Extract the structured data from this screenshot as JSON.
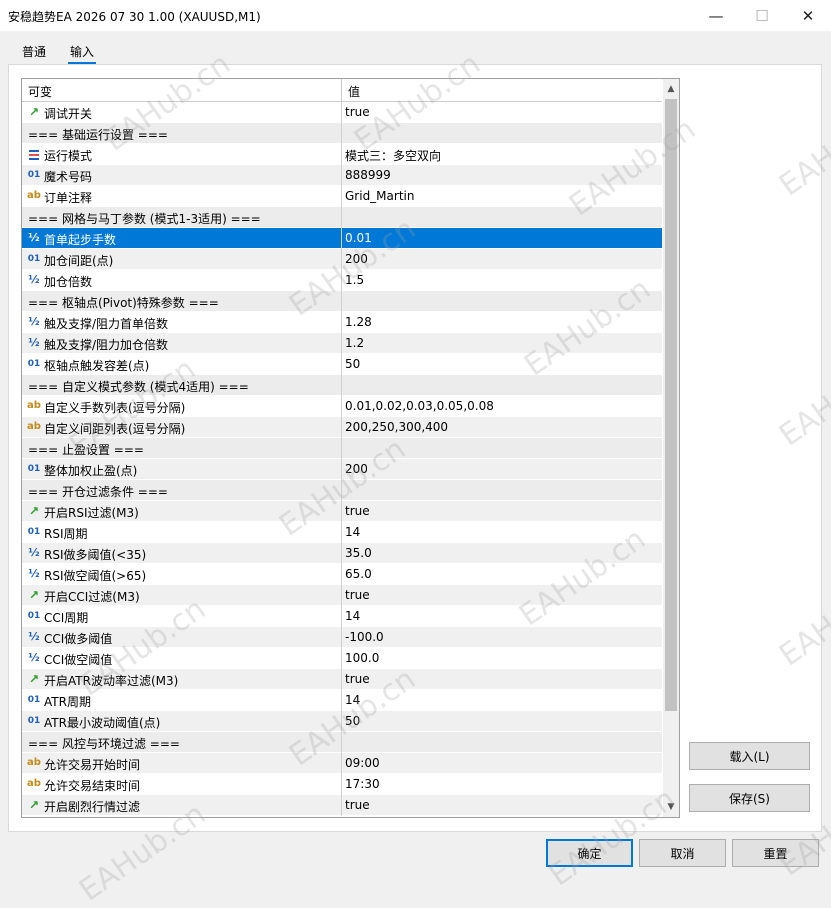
{
  "window": {
    "title": "安稳趋势EA 2026 07 30 1.00 (XAUUSD,M1)",
    "minimize": "—",
    "maximize": "☐",
    "close": "✕"
  },
  "tabs": [
    "普通",
    "输入"
  ],
  "grid": {
    "col_name": "可变",
    "col_value": "值",
    "rows": [
      {
        "type": "bool",
        "name": "调试开关",
        "value": "true"
      },
      {
        "type": "section",
        "name": "=== 基础运行设置 ===",
        "value": ""
      },
      {
        "type": "enum",
        "name": "运行模式",
        "value": "模式三：多空双向"
      },
      {
        "type": "int",
        "name": "魔术号码",
        "value": "888999"
      },
      {
        "type": "string",
        "name": "订单注释",
        "value": "Grid_Martin"
      },
      {
        "type": "section",
        "name": "=== 网格与马丁参数 (模式1-3适用) ===",
        "value": ""
      },
      {
        "type": "double",
        "name": "首单起步手数",
        "value": "0.01",
        "selected": true
      },
      {
        "type": "int",
        "name": "加仓间距(点)",
        "value": "200"
      },
      {
        "type": "double",
        "name": "加仓倍数",
        "value": "1.5"
      },
      {
        "type": "section",
        "name": "=== 枢轴点(Pivot)特殊参数 ===",
        "value": ""
      },
      {
        "type": "double",
        "name": "触及支撑/阻力首单倍数",
        "value": "1.28"
      },
      {
        "type": "double",
        "name": "触及支撑/阻力加仓倍数",
        "value": "1.2"
      },
      {
        "type": "int",
        "name": "枢轴点触发容差(点)",
        "value": "50"
      },
      {
        "type": "section",
        "name": "=== 自定义模式参数 (模式4适用) ===",
        "value": ""
      },
      {
        "type": "string",
        "name": "自定义手数列表(逗号分隔)",
        "value": "0.01,0.02,0.03,0.05,0.08"
      },
      {
        "type": "string",
        "name": "自定义间距列表(逗号分隔)",
        "value": "200,250,300,400"
      },
      {
        "type": "section",
        "name": "=== 止盈设置 ===",
        "value": ""
      },
      {
        "type": "int",
        "name": "整体加权止盈(点)",
        "value": "200"
      },
      {
        "type": "section",
        "name": "=== 开仓过滤条件 ===",
        "value": ""
      },
      {
        "type": "bool",
        "name": "开启RSI过滤(M3)",
        "value": "true"
      },
      {
        "type": "int",
        "name": "RSI周期",
        "value": "14"
      },
      {
        "type": "double",
        "name": "RSI做多阈值(<35)",
        "value": "35.0"
      },
      {
        "type": "double",
        "name": "RSI做空阈值(>65)",
        "value": "65.0"
      },
      {
        "type": "bool",
        "name": "开启CCI过滤(M3)",
        "value": "true"
      },
      {
        "type": "int",
        "name": "CCI周期",
        "value": "14"
      },
      {
        "type": "double",
        "name": "CCI做多阈值",
        "value": "-100.0"
      },
      {
        "type": "double",
        "name": "CCI做空阈值",
        "value": "100.0"
      },
      {
        "type": "bool",
        "name": "开启ATR波动率过滤(M3)",
        "value": "true"
      },
      {
        "type": "int",
        "name": "ATR周期",
        "value": "14"
      },
      {
        "type": "int",
        "name": "ATR最小波动阈值(点)",
        "value": "50"
      },
      {
        "type": "section",
        "name": "=== 风控与环境过滤 ===",
        "value": ""
      },
      {
        "type": "string",
        "name": "允许交易开始时间",
        "value": "09:00"
      },
      {
        "type": "string",
        "name": "允许交易结束时间",
        "value": "17:30"
      },
      {
        "type": "bool",
        "name": "开启剧烈行情过滤",
        "value": "true"
      }
    ]
  },
  "icons": {
    "bool": "↗",
    "int": "01",
    "double": "½",
    "string": "ab"
  },
  "buttons": {
    "load": "载入(L)",
    "save": "保存(S)",
    "ok": "确定",
    "cancel": "取消",
    "reset": "重置"
  },
  "watermark": "EAHub.cn",
  "colors": {
    "selection": "#0078d7",
    "accent": "#0078d7"
  }
}
